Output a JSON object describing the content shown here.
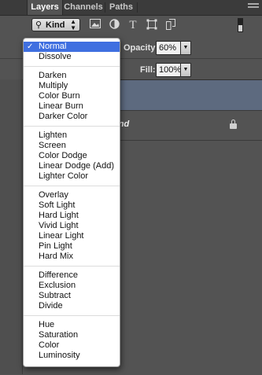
{
  "tabs": [
    {
      "label": "Layers",
      "active": true
    },
    {
      "label": "Channels",
      "active": false
    },
    {
      "label": "Paths",
      "active": false
    }
  ],
  "filter": {
    "kind_label": "Kind",
    "icons": [
      "image-filter-icon",
      "adjustment-filter-icon",
      "type-filter-icon",
      "shape-filter-icon",
      "smart-object-filter-icon"
    ]
  },
  "opacity": {
    "label": "Opacity:",
    "value": "60%"
  },
  "fill": {
    "label": "Fill:",
    "value": "100%"
  },
  "layers": [
    {
      "name": "",
      "selected": true
    },
    {
      "name": "Background",
      "selected": false,
      "locked": true
    }
  ],
  "blend_menu": {
    "selected": "Normal",
    "groups": [
      [
        "Normal",
        "Dissolve"
      ],
      [
        "Darken",
        "Multiply",
        "Color Burn",
        "Linear Burn",
        "Darker Color"
      ],
      [
        "Lighten",
        "Screen",
        "Color Dodge",
        "Linear Dodge (Add)",
        "Lighter Color"
      ],
      [
        "Overlay",
        "Soft Light",
        "Hard Light",
        "Vivid Light",
        "Linear Light",
        "Pin Light",
        "Hard Mix"
      ],
      [
        "Difference",
        "Exclusion",
        "Subtract",
        "Divide"
      ],
      [
        "Hue",
        "Saturation",
        "Color",
        "Luminosity"
      ]
    ]
  },
  "colors": {
    "panel_bg": "#535353",
    "tabbar_bg": "#3b3b3b",
    "menu_highlight": "#3f6fe0",
    "selected_layer": "#5d6a7f"
  }
}
